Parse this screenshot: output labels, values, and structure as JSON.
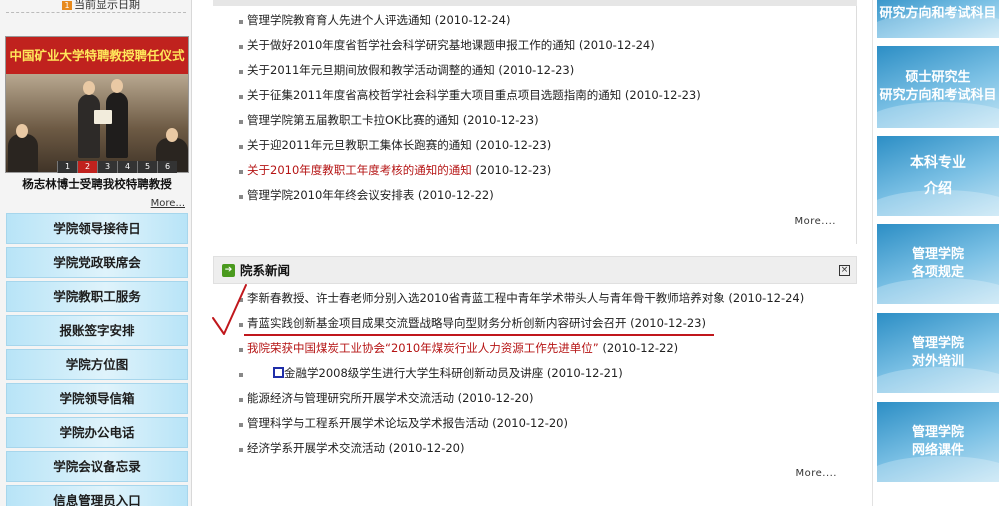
{
  "left": {
    "date_row": {
      "number": "1",
      "text": "当前显示日期"
    },
    "slideshow": {
      "banner": "中国矿业大学特聘教授聘任仪式",
      "numbers": [
        "1",
        "2",
        "3",
        "4",
        "5",
        "6"
      ],
      "active_number": "2",
      "caption": "杨志林博士受聘我校特聘教授",
      "more": "More..."
    },
    "menu": [
      "学院领导接待日",
      "学院党政联席会",
      "学院教职工服务",
      "报账签字安排",
      "学院方位图",
      "学院领导信箱",
      "学院办公电话",
      "学院会议备忘录",
      "信息管理员入口"
    ]
  },
  "center": {
    "top_list": [
      {
        "title": "管理学院教育育人先进个人评选通知",
        "date": "(2010-12-24)",
        "color": "normal"
      },
      {
        "title": "关于做好2010年度省哲学社会科学研究基地课题申报工作的通知",
        "date": "(2010-12-24)",
        "color": "normal"
      },
      {
        "title": "关于2011年元旦期间放假和教学活动调整的通知",
        "date": "(2010-12-23)",
        "color": "normal"
      },
      {
        "title": "关于征集2011年度省高校哲学社会科学重大项目重点项目选题指南的通知",
        "date": "(2010-12-23)",
        "color": "normal"
      },
      {
        "title": "管理学院第五届教职工卡拉OK比赛的通知",
        "date": "(2010-12-23)",
        "color": "normal"
      },
      {
        "title": "关于迎2011年元旦教职工集体长跑赛的通知",
        "date": "(2010-12-23)",
        "color": "normal"
      },
      {
        "title": "关于2010年度教职工年度考核的通知的通知",
        "date": "(2010-12-23)",
        "color": "red"
      },
      {
        "title": "管理学院2010年年终会议安排表",
        "date": "(2010-12-22)",
        "color": "normal"
      }
    ],
    "top_more": "More....",
    "news_section": {
      "title": "院系新闻",
      "close_glyph": "×",
      "items": [
        {
          "title": "李新春教授、许士春老师分别入选2010省青蓝工程中青年学术带头人与青年骨干教师培养对象",
          "date": "(2010-12-24)",
          "color": "normal"
        },
        {
          "title": "青蓝实践创新基金项目成果交流暨战略导向型财务分析创新内容研讨会召开",
          "date": "(2010-12-23)",
          "color": "normal"
        },
        {
          "title": "我院荣获中国煤炭工业协会“2010年煤炭行业人力资源工作先进单位”",
          "date": "(2010-12-22)",
          "color": "red"
        },
        {
          "title": "金融学2008级学生进行大学生科研创新动员及讲座",
          "date": "(2010-12-21)",
          "color": "normal"
        },
        {
          "title": "能源经济与管理研究所开展学术交流活动",
          "date": "(2010-12-20)",
          "color": "normal"
        },
        {
          "title": "管理科学与工程系开展学术论坛及学术报告活动",
          "date": "(2010-12-20)",
          "color": "normal"
        },
        {
          "title": "经济学系开展学术交流活动",
          "date": "(2010-12-20)",
          "color": "normal"
        }
      ],
      "more": "More...."
    }
  },
  "right": {
    "boxes": [
      {
        "line1": "研究方向和考试科目",
        "line2": ""
      },
      {
        "line1": "硕士研究生",
        "line2": "研究方向和考试科目"
      },
      {
        "line1": "本科专业",
        "line2": "介绍"
      },
      {
        "line1": "管理学院",
        "line2": "各项规定"
      },
      {
        "line1": "管理学院",
        "line2": "对外培训"
      },
      {
        "line1": "管理学院",
        "line2": "网络课件"
      }
    ]
  },
  "colors": {
    "menu_button": "#b8e4f7",
    "red_text": "#b51414",
    "annotation_red": "#c0171c",
    "annotation_blue": "#1f2ea8",
    "right_box": "#2c8ec5",
    "section_arrow": "#4a9a1e"
  }
}
